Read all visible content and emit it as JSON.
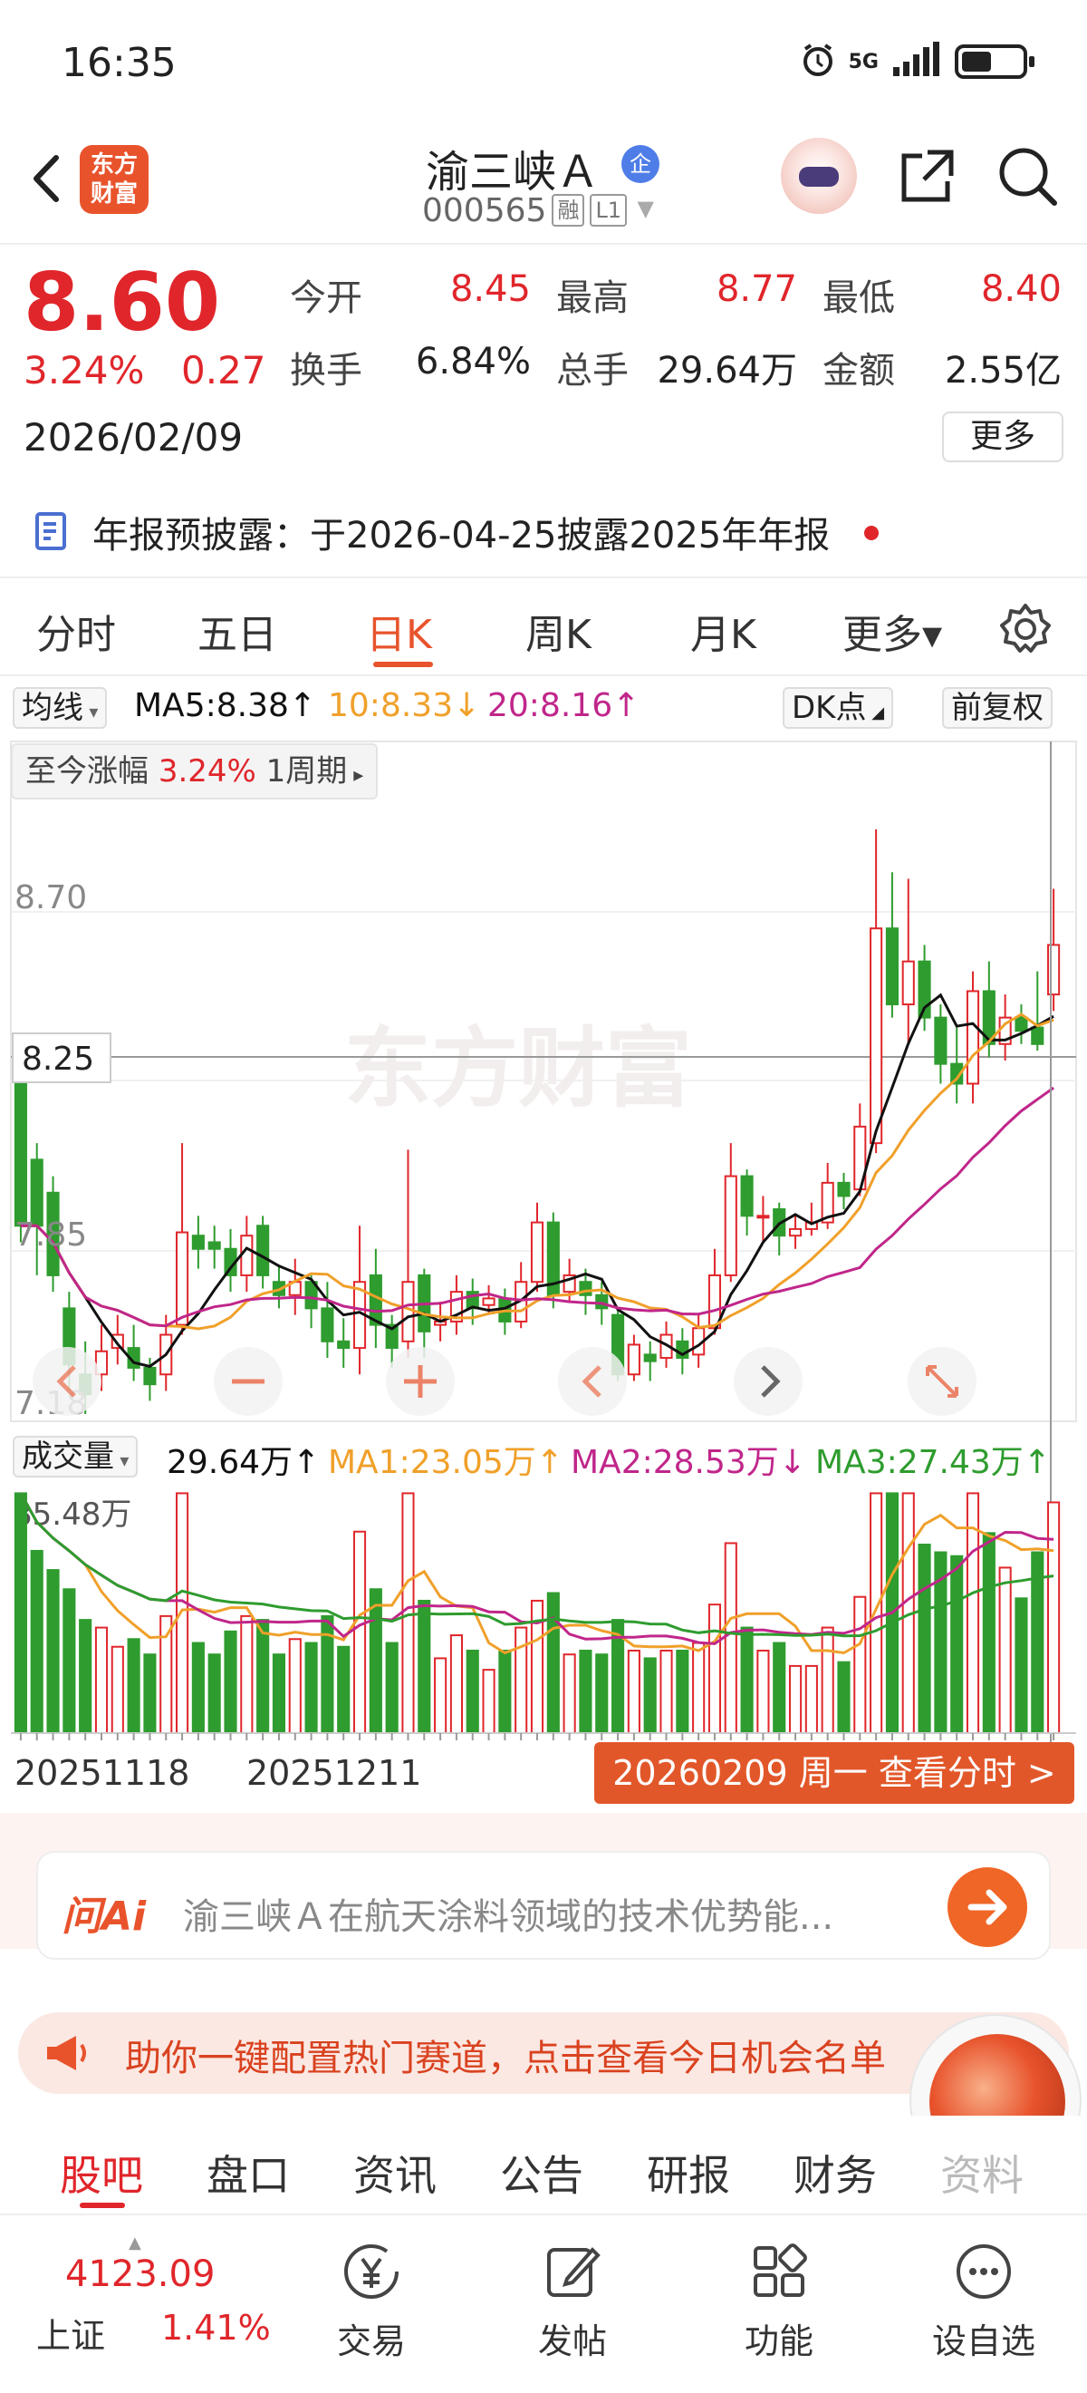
{
  "status_bar": {
    "time": "16:35",
    "network": "5G",
    "battery_level": 0.5
  },
  "header": {
    "logo_text": "东方\n财富",
    "stock_name": "渝三峡Ａ",
    "badge": "企",
    "stock_code": "000565",
    "tags": [
      "融",
      "L1"
    ]
  },
  "quote": {
    "price": "8.60",
    "change_pct": "3.24%",
    "change_amt": "0.27",
    "date": "2026/02/09",
    "fields": [
      {
        "label": "今开",
        "value": "8.45"
      },
      {
        "label": "最高",
        "value": "8.77"
      },
      {
        "label": "最低",
        "value": "8.40"
      },
      {
        "label": "换手",
        "value": "6.84%"
      },
      {
        "label": "总手",
        "value": "29.64万"
      },
      {
        "label": "金额",
        "value": "2.55亿"
      }
    ],
    "more_label": "更多"
  },
  "notice": {
    "text": "年报预披露：于2026-04-25披露2025年年报"
  },
  "period_tabs": [
    "分时",
    "五日",
    "日K",
    "周K",
    "月K",
    "更多▾"
  ],
  "active_period": "日K",
  "ma_legend": {
    "selector": "均线",
    "ma5": "MA5:8.38↑",
    "ma10": "10:8.33↓",
    "ma20": "20:8.16↑",
    "dk_label": "DK点",
    "adjust_label": "前复权"
  },
  "change_info": {
    "label": "至今涨幅",
    "value": "3.24%",
    "period": "1周期"
  },
  "price_axis": {
    "top": "8.70",
    "marker": "8.25",
    "mid": "7.85",
    "bottom": "7.18"
  },
  "watermark": "东方财富",
  "volume_legend": {
    "selector": "成交量",
    "vol": "29.64万↑",
    "ma1": "MA1:23.05万↑",
    "ma2": "MA2:28.53万↓",
    "ma3": "MA3:27.43万↑",
    "axis_max": "85.48万"
  },
  "x_dates": [
    "20251118",
    "20251211"
  ],
  "view_fenshi": "20260209 周一 查看分时 >",
  "colors": {
    "up": "#e0262b",
    "down": "#2e9c2e",
    "ma5": "#111111",
    "ma10": "#f0a02a",
    "ma20": "#c0268a",
    "accent": "#e8532c"
  },
  "chart_data": {
    "type": "candlestick",
    "x": [
      "2025-11-18",
      "2025-12-11",
      "2026-02-09"
    ],
    "ylim": [
      7.18,
      8.7
    ],
    "candles": [
      [
        8.2,
        7.75,
        8.25,
        7.7
      ],
      [
        7.95,
        7.75,
        8.0,
        7.6
      ],
      [
        7.85,
        7.6,
        7.9,
        7.55
      ],
      [
        7.5,
        7.33,
        7.55,
        7.25
      ],
      [
        7.3,
        7.24,
        7.4,
        7.18
      ],
      [
        7.3,
        7.37,
        7.45,
        7.25
      ],
      [
        7.38,
        7.42,
        7.48,
        7.33
      ],
      [
        7.38,
        7.32,
        7.45,
        7.28
      ],
      [
        7.32,
        7.27,
        7.35,
        7.22
      ],
      [
        7.3,
        7.42,
        7.48,
        7.25
      ],
      [
        7.45,
        7.73,
        8.0,
        7.42
      ],
      [
        7.72,
        7.68,
        7.78,
        7.62
      ],
      [
        7.7,
        7.68,
        7.75,
        7.62
      ],
      [
        7.68,
        7.6,
        7.74,
        7.55
      ],
      [
        7.6,
        7.72,
        7.78,
        7.55
      ],
      [
        7.75,
        7.6,
        7.78,
        7.56
      ],
      [
        7.58,
        7.54,
        7.63,
        7.5
      ],
      [
        7.54,
        7.58,
        7.65,
        7.48
      ],
      [
        7.58,
        7.5,
        7.6,
        7.44
      ],
      [
        7.5,
        7.4,
        7.58,
        7.35
      ],
      [
        7.4,
        7.38,
        7.47,
        7.32
      ],
      [
        7.38,
        7.58,
        7.75,
        7.3
      ],
      [
        7.6,
        7.45,
        7.68,
        7.38
      ],
      [
        7.45,
        7.38,
        7.48,
        7.32
      ],
      [
        7.4,
        7.58,
        7.98,
        7.35
      ],
      [
        7.6,
        7.43,
        7.62,
        7.35
      ],
      [
        7.45,
        7.46,
        7.52,
        7.4
      ],
      [
        7.46,
        7.55,
        7.6,
        7.42
      ],
      [
        7.55,
        7.5,
        7.59,
        7.45
      ],
      [
        7.51,
        7.53,
        7.57,
        7.48
      ],
      [
        7.53,
        7.46,
        7.56,
        7.42
      ],
      [
        7.46,
        7.58,
        7.64,
        7.44
      ],
      [
        7.58,
        7.76,
        7.82,
        7.55
      ],
      [
        7.76,
        7.54,
        7.79,
        7.5
      ],
      [
        7.55,
        7.6,
        7.65,
        7.52
      ],
      [
        7.58,
        7.54,
        7.62,
        7.48
      ],
      [
        7.54,
        7.5,
        7.58,
        7.45
      ],
      [
        7.48,
        7.3,
        7.5,
        7.28
      ],
      [
        7.3,
        7.39,
        7.42,
        7.28
      ],
      [
        7.36,
        7.34,
        7.4,
        7.28
      ],
      [
        7.35,
        7.42,
        7.46,
        7.32
      ],
      [
        7.4,
        7.35,
        7.44,
        7.3
      ],
      [
        7.36,
        7.44,
        7.48,
        7.32
      ],
      [
        7.44,
        7.6,
        7.68,
        7.42
      ],
      [
        7.6,
        7.9,
        8.0,
        7.58
      ],
      [
        7.9,
        7.78,
        7.92,
        7.72
      ],
      [
        7.78,
        7.78,
        7.84,
        7.7
      ],
      [
        7.8,
        7.72,
        7.82,
        7.66
      ],
      [
        7.72,
        7.74,
        7.78,
        7.68
      ],
      [
        7.74,
        7.76,
        7.82,
        7.72
      ],
      [
        7.76,
        7.88,
        7.94,
        7.74
      ],
      [
        7.88,
        7.84,
        7.91,
        7.8
      ],
      [
        7.86,
        8.05,
        8.12,
        7.84
      ],
      [
        8.0,
        8.65,
        8.95,
        7.97
      ],
      [
        8.65,
        8.42,
        8.82,
        8.38
      ],
      [
        8.42,
        8.55,
        8.8,
        8.3
      ],
      [
        8.55,
        8.38,
        8.6,
        8.34
      ],
      [
        8.38,
        8.24,
        8.42,
        8.18
      ],
      [
        8.24,
        8.18,
        8.35,
        8.12
      ],
      [
        8.18,
        8.46,
        8.52,
        8.12
      ],
      [
        8.46,
        8.3,
        8.55,
        8.26
      ],
      [
        8.3,
        8.38,
        8.45,
        8.25
      ],
      [
        8.38,
        8.34,
        8.42,
        8.3
      ],
      [
        8.35,
        8.3,
        8.52,
        8.28
      ],
      [
        8.45,
        8.6,
        8.77,
        8.4
      ]
    ],
    "volume_max": "85.48万"
  },
  "ai": {
    "logo": "问Ai",
    "placeholder": "渝三峡Ａ在航天涂料领域的技术优势能..."
  },
  "promo": {
    "text": "助你一键配置热门赛道，点击查看今日机会名单"
  },
  "bottom_tabs": [
    "股吧",
    "盘口",
    "资讯",
    "公告",
    "研报",
    "财务",
    "资料"
  ],
  "nav": {
    "index_value": "4123.09",
    "index_name": "上证",
    "index_pct": "1.41%",
    "items": [
      "交易",
      "发帖",
      "功能",
      "设自选"
    ]
  }
}
